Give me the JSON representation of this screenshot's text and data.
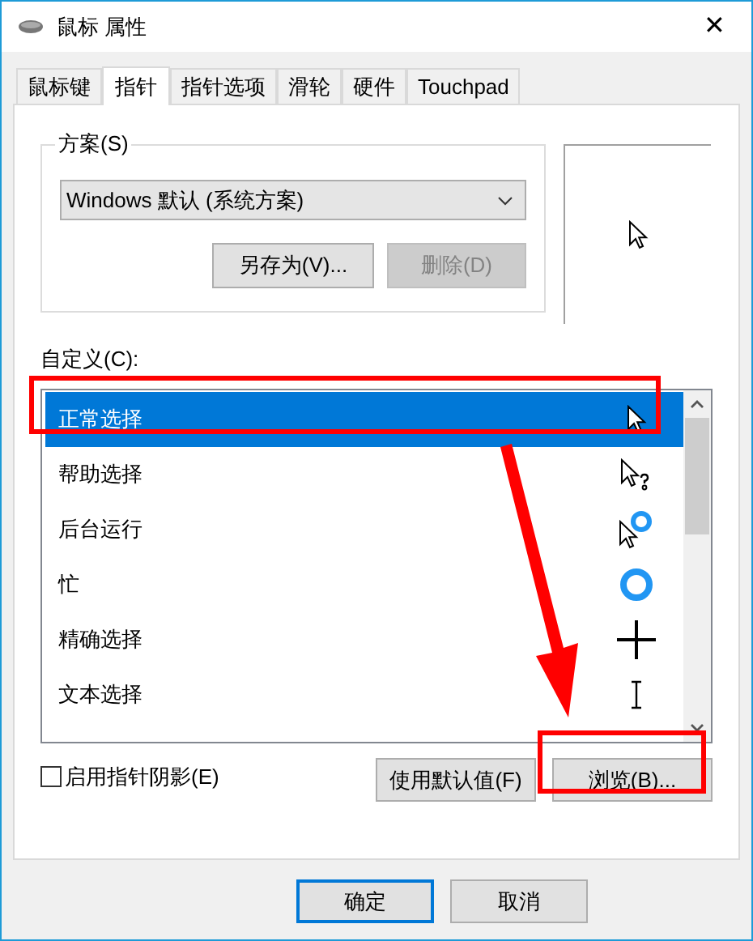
{
  "window": {
    "title": "鼠标 属性",
    "close": "✕"
  },
  "tabs": [
    {
      "label": "鼠标键",
      "selected": false
    },
    {
      "label": "指针",
      "selected": true
    },
    {
      "label": "指针选项",
      "selected": false
    },
    {
      "label": "滑轮",
      "selected": false
    },
    {
      "label": "硬件",
      "selected": false
    },
    {
      "label": "Touchpad",
      "selected": false
    }
  ],
  "scheme": {
    "label": "方案(S)",
    "value": "Windows 默认 (系统方案)",
    "buttons": [
      {
        "label": "另存为(V)...",
        "disabled": false
      },
      {
        "label": "删除(D)",
        "disabled": true
      }
    ]
  },
  "customize": {
    "label": "自定义(C):",
    "rows": [
      {
        "label": "正常选择",
        "kind": "arrow",
        "selected": true
      },
      {
        "label": "帮助选择",
        "kind": "help",
        "selected": false
      },
      {
        "label": "后台运行",
        "kind": "working",
        "selected": false
      },
      {
        "label": "忙",
        "kind": "busy",
        "selected": false
      },
      {
        "label": "精确选择",
        "kind": "cross",
        "selected": false
      },
      {
        "label": "文本选择",
        "kind": "text",
        "selected": false
      }
    ]
  },
  "shadow": {
    "label": "启用指针阴影(E)",
    "checked": false
  },
  "list_buttons": [
    "使用默认值(F)",
    "浏览(B)..."
  ],
  "dialog_buttons": [
    {
      "label": "确定",
      "default": true
    },
    {
      "label": "取消",
      "default": false
    }
  ]
}
